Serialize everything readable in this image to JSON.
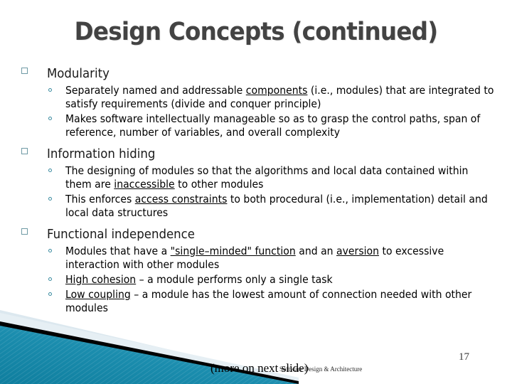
{
  "slide": {
    "title": "Design Concepts (continued)",
    "page_number": "17",
    "footer_note": "(more on next slide)",
    "footer_credit": "Software Design & Architecture",
    "colors": {
      "title": "#434343",
      "body_text": "#000000",
      "level1_bullet": "#6f9aa5",
      "level2_bullet": "#3a8ba0",
      "deco_teal_dark": "#1787a6",
      "deco_teal_light": "#55b0c8",
      "deco_pale_blue": "#dce8ef",
      "deco_black": "#000000",
      "background": "#ffffff"
    },
    "sections": [
      {
        "heading": "Modularity",
        "bullet_marker": "square-outline",
        "points": [
          {
            "parts": [
              {
                "text": "Separately named and addressable ",
                "underline": false
              },
              {
                "text": "components",
                "underline": true
              },
              {
                "text": " (i.e., modules) that are integrated to satisfy requirements (divide and conquer principle)",
                "underline": false
              }
            ]
          },
          {
            "parts": [
              {
                "text": "Makes software intellectually manageable so as to grasp the control paths, span of reference, number of variables, and overall complexity",
                "underline": false
              }
            ]
          }
        ]
      },
      {
        "heading": "Information hiding",
        "bullet_marker": "square-outline",
        "points": [
          {
            "parts": [
              {
                "text": "The designing of modules so that the algorithms and local data contained within them are ",
                "underline": false
              },
              {
                "text": "inaccessible",
                "underline": true
              },
              {
                "text": " to other modules",
                "underline": false
              }
            ]
          },
          {
            "parts": [
              {
                "text": "This enforces ",
                "underline": false
              },
              {
                "text": "access constraints",
                "underline": true
              },
              {
                "text": " to both procedural (i.e., implementation) detail and local data structures",
                "underline": false
              }
            ]
          }
        ]
      },
      {
        "heading": "Functional independence",
        "bullet_marker": "square-outline",
        "points": [
          {
            "parts": [
              {
                "text": "Modules that have a ",
                "underline": false
              },
              {
                "text": "\"single–minded\" function",
                "underline": true
              },
              {
                "text": " and an ",
                "underline": false
              },
              {
                "text": "aversion",
                "underline": true
              },
              {
                "text": " to excessive interaction with other modules",
                "underline": false
              }
            ]
          },
          {
            "parts": [
              {
                "text": "High cohesion",
                "underline": true
              },
              {
                "text": " – a module performs only a single task",
                "underline": false
              }
            ]
          },
          {
            "parts": [
              {
                "text": "Low coupling",
                "underline": true
              },
              {
                "text": " – a module has the lowest amount of connection needed with other modules",
                "underline": false
              }
            ]
          }
        ]
      }
    ]
  }
}
